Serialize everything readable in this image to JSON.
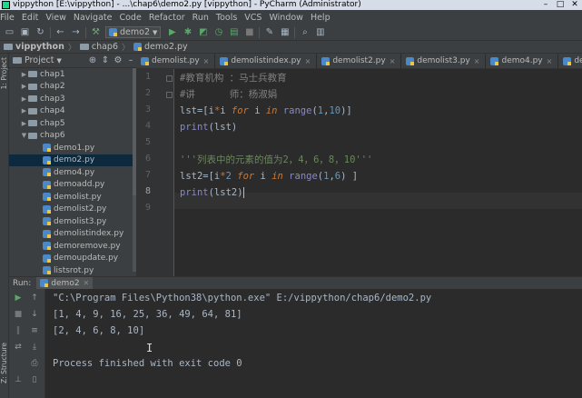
{
  "window": {
    "title": "vippython [E:\\vippython] - ...\\chap6\\demo2.py [vippython] - PyCharm (Administrator)"
  },
  "menu": [
    "File",
    "Edit",
    "View",
    "Navigate",
    "Code",
    "Refactor",
    "Run",
    "Tools",
    "VCS",
    "Window",
    "Help"
  ],
  "toolbar": {
    "run_config": "demo2"
  },
  "breadcrumb": [
    "vippython",
    "chap6",
    "demo2.py"
  ],
  "side_labels": {
    "project": "1: Project",
    "structure": "Z: Structure"
  },
  "project": {
    "title": "Project",
    "tree": [
      {
        "label": "chap1",
        "type": "folder",
        "depth": 1,
        "expanded": false
      },
      {
        "label": "chap2",
        "type": "folder",
        "depth": 1,
        "expanded": false
      },
      {
        "label": "chap3",
        "type": "folder",
        "depth": 1,
        "expanded": false
      },
      {
        "label": "chap4",
        "type": "folder",
        "depth": 1,
        "expanded": false
      },
      {
        "label": "chap5",
        "type": "folder",
        "depth": 1,
        "expanded": false
      },
      {
        "label": "chap6",
        "type": "folder",
        "depth": 1,
        "expanded": true
      },
      {
        "label": "demo1.py",
        "type": "file",
        "depth": 2
      },
      {
        "label": "demo2.py",
        "type": "file",
        "depth": 2,
        "selected": true
      },
      {
        "label": "demo4.py",
        "type": "file",
        "depth": 2
      },
      {
        "label": "demoadd.py",
        "type": "file",
        "depth": 2
      },
      {
        "label": "demolist.py",
        "type": "file",
        "depth": 2
      },
      {
        "label": "demolist2.py",
        "type": "file",
        "depth": 2
      },
      {
        "label": "demolist3.py",
        "type": "file",
        "depth": 2
      },
      {
        "label": "demolistindex.py",
        "type": "file",
        "depth": 2
      },
      {
        "label": "demoremove.py",
        "type": "file",
        "depth": 2
      },
      {
        "label": "demoupdate.py",
        "type": "file",
        "depth": 2
      },
      {
        "label": "listsrot.py",
        "type": "file",
        "depth": 2
      }
    ]
  },
  "editor": {
    "tabs": [
      {
        "label": "demolist.py",
        "active": false
      },
      {
        "label": "demolistindex.py",
        "active": false
      },
      {
        "label": "demolist2.py",
        "active": false
      },
      {
        "label": "demolist3.py",
        "active": false
      },
      {
        "label": "demo4.py",
        "active": false
      },
      {
        "label": "demoadd.py",
        "active": false
      }
    ],
    "tabs_overflow": "≡",
    "current_line": 8,
    "lines": [
      "#教育机构 ：马士兵教育",
      "#讲      师：杨淑娟",
      "lst=[i*i for i in range(1,10)]",
      "print(lst)",
      "",
      "'''列表中的元素的值为2，4，6，8，10'''",
      "lst2=[i*2 for i in range(1,6) ]",
      "print(lst2)",
      ""
    ]
  },
  "run": {
    "label": "Run:",
    "tab": "demo2",
    "console": [
      "\"C:\\Program Files\\Python38\\python.exe\" E:/vippython/chap6/demo2.py",
      "[1, 4, 9, 16, 25, 36, 49, 64, 81]",
      "[2, 4, 6, 8, 10]",
      "",
      "Process finished with exit code 0"
    ]
  }
}
